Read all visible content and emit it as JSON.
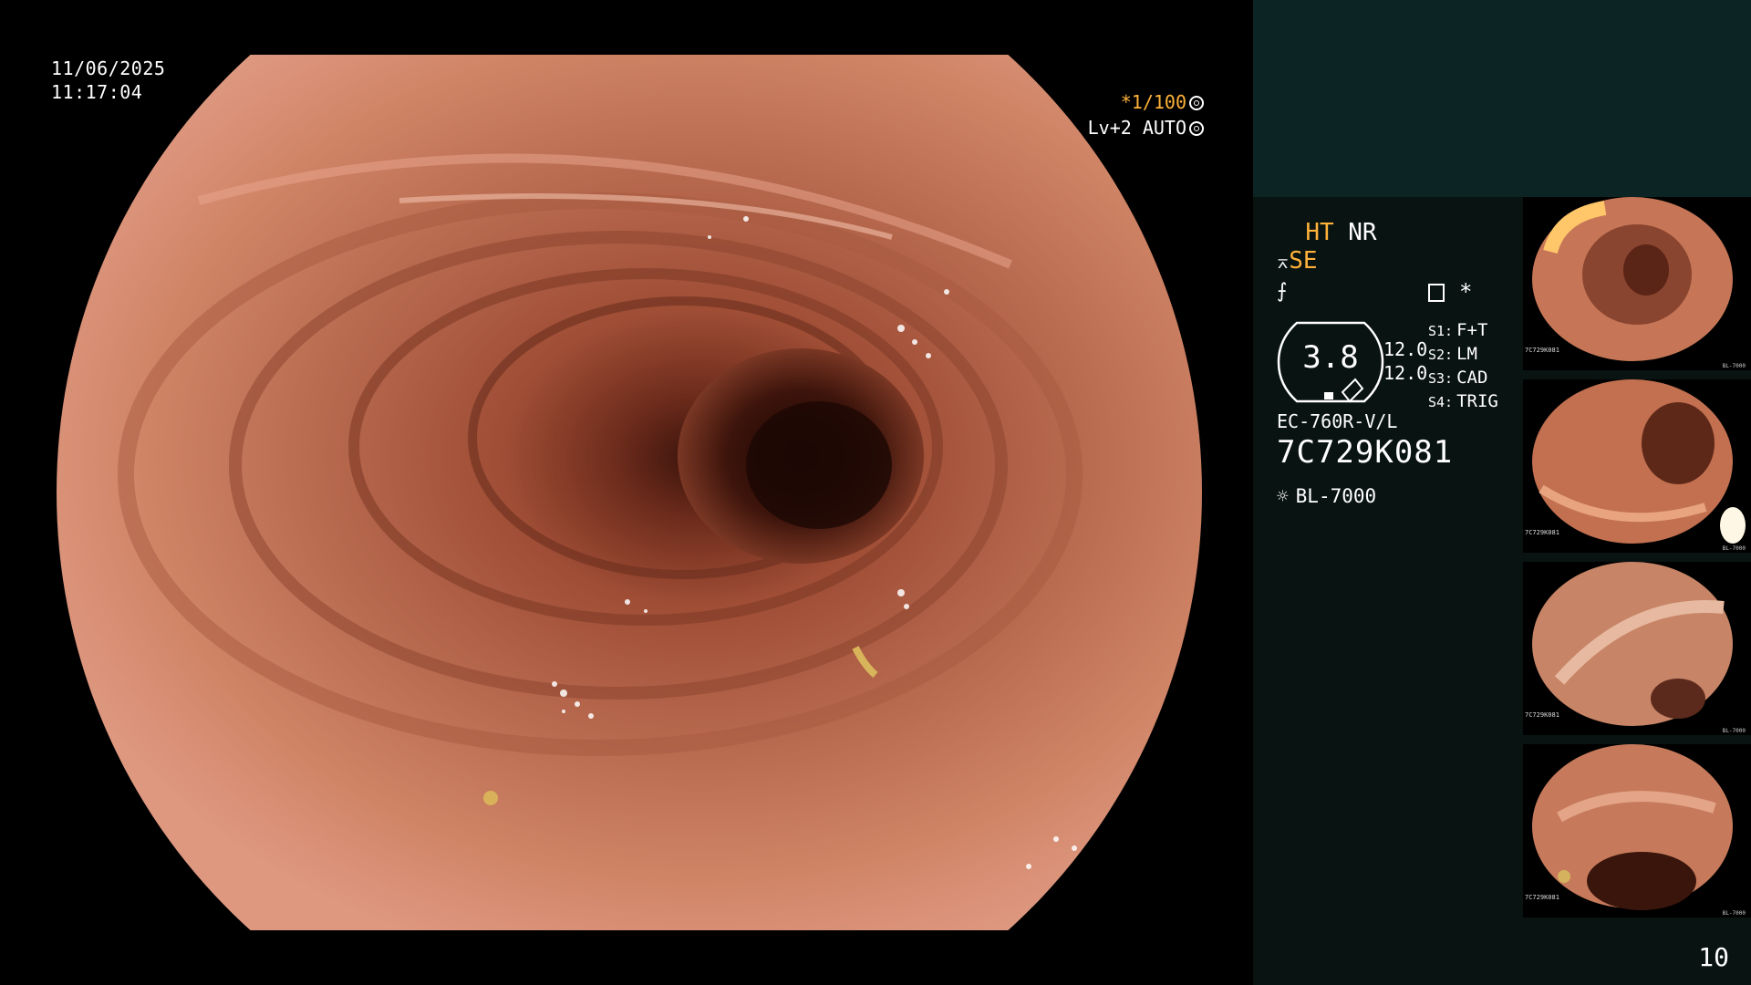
{
  "overlay": {
    "date": "11/06/2025",
    "time": "11:17:04",
    "shutter": "*1/100",
    "level_mode": "Lv+2 AUTO"
  },
  "panel": {
    "ht": "HT",
    "nr": "NR",
    "se": "SE",
    "gauge_value": "3.8",
    "gauge_side_1": "12.0",
    "gauge_side_2": "12.0",
    "switches": [
      {
        "key": "S1:",
        "value": "F+T"
      },
      {
        "key": "S2:",
        "value": "LM"
      },
      {
        "key": "S3:",
        "value": "CAD"
      },
      {
        "key": "S4:",
        "value": "TRIG"
      }
    ],
    "scope_model": "EC-760R-V/L",
    "serial": "7C729K081",
    "light_source": "BL-7000",
    "star": "*"
  },
  "thumbnails": [
    {
      "label": "7C729K081",
      "foot": "BL-7000"
    },
    {
      "label": "7C729K081",
      "foot": "BL-7000"
    },
    {
      "label": "7C729K081",
      "foot": "BL-7000"
    },
    {
      "label": "7C729K081",
      "foot": "BL-7000"
    }
  ],
  "page_number": "10",
  "colors": {
    "accent_yellow": "#ffb23a",
    "panel_bg": "#091312",
    "panel_top_bg": "#0c2524",
    "mucosa": "#c8775c"
  }
}
